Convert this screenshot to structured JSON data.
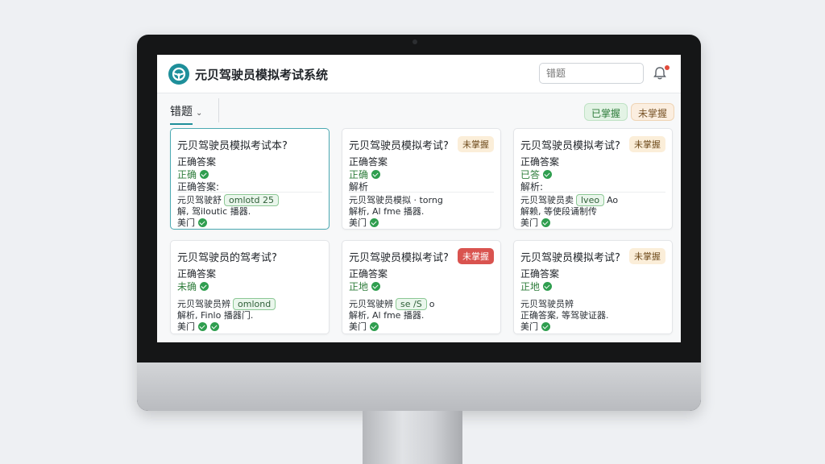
{
  "app": {
    "title": "元贝驾驶员模拟考试系统",
    "search_placeholder": "错题"
  },
  "toolbar": {
    "filter_label": "错题",
    "pill_mastered": "已掌握",
    "pill_unmastered": "未掌握"
  },
  "cards": [
    {
      "question": "元贝驾驶员模拟考试本?",
      "answer_label": "正确答案",
      "answer": "正确",
      "extra": "正确答案:",
      "line1_text": "元贝驾驶舒",
      "line1_chip": "omlotd 25",
      "line2_text": "解,  驾iloutic 播器.",
      "line3_text": "美门",
      "badge": ""
    },
    {
      "question": "元贝驾驶员模拟考试?",
      "answer_label": "正确答案",
      "answer": "正确",
      "extra": "解析",
      "line1_text": "元贝驾驶员模拟 · torng",
      "line1_chip": "",
      "line2_text": "解析, Al fme 播器.",
      "line3_text": "美门",
      "badge": "未掌握"
    },
    {
      "question": "元贝驾驶员模拟考试?",
      "answer_label": "正确答案",
      "answer": "已答",
      "extra": "解析:",
      "line1_text": "元贝驾驶员卖",
      "line1_chip": "lveo",
      "line1_after": "Ao",
      "line2_text": "解赖, 等使段诵制传",
      "line3_text": "美门",
      "badge": "未掌握"
    },
    {
      "question": "元贝驾驶员的驾考试?",
      "answer_label": "正确答案",
      "answer": "未确",
      "extra": "",
      "line1_text": "元贝驾驶员辨",
      "line1_chip": "omlond",
      "line2_text": "解析, Finlo 播器门.",
      "line3_text": "美门",
      "badge": ""
    },
    {
      "question": "元贝驾驶员模拟考试?",
      "answer_label": "正确答案",
      "answer": "正地",
      "extra": "",
      "line1_text": "元贝驾驶辨",
      "line1_chip": "se /S",
      "line1_after": "o",
      "line2_text": "解析, Al fme 播器.",
      "line3_text": "美门",
      "badge": "未掌握"
    },
    {
      "question": "元贝驾驶员模拟考试?",
      "answer_label": "正确答案",
      "answer": "正地",
      "extra": "",
      "line1_text": "元贝驾驶员辨",
      "line1_chip": "",
      "line2_text": "正确答案, 等驾驶证器.",
      "line3_text": "美门",
      "badge": "未掌握"
    }
  ]
}
